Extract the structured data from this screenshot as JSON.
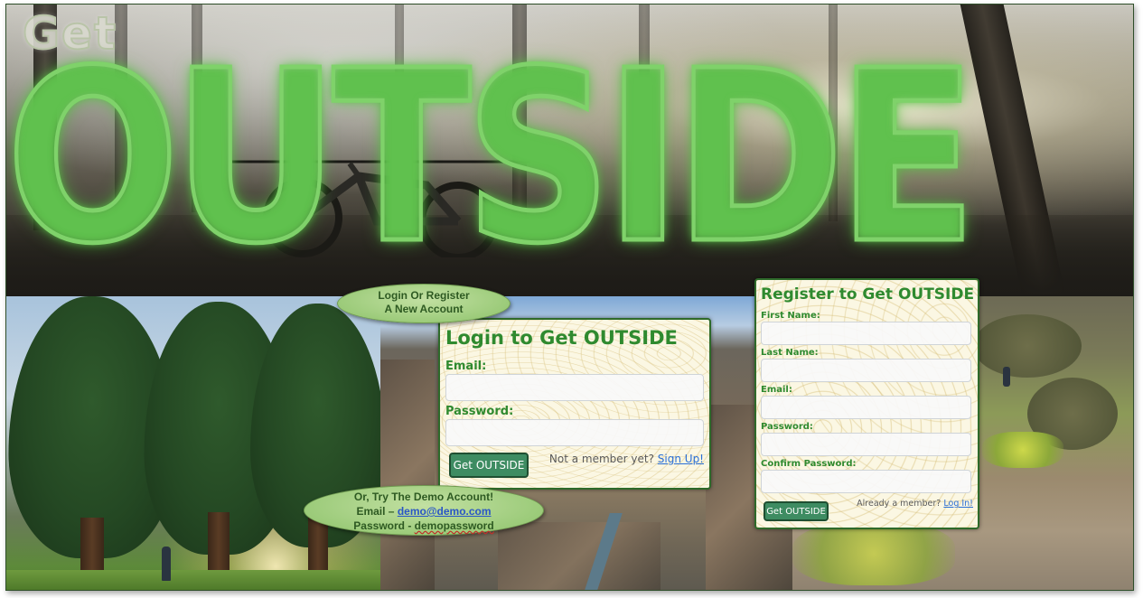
{
  "hero": {
    "get_text": "Get",
    "outside_text": "OUTSIDE"
  },
  "callout_top": {
    "line1": "Login Or Register",
    "line2": "A New Account"
  },
  "callout_demo": {
    "line1": "Or, Try The Demo Account!",
    "email_prefix": "Email – ",
    "email": "demo@demo.com",
    "password_prefix": "Password - ",
    "password": "demopassword"
  },
  "login": {
    "title": "Login to Get OUTSIDE",
    "email_label": "Email:",
    "password_label": "Password:",
    "email_value": "",
    "password_value": "",
    "button_label": "Get OUTSIDE",
    "signup_prompt": "Not a member yet?",
    "signup_link": "Sign Up!"
  },
  "register": {
    "title": "Register to Get OUTSIDE",
    "first_name_label": "First Name:",
    "last_name_label": "Last Name:",
    "email_label": "Email:",
    "password_label": "Password:",
    "confirm_password_label": "Confirm Password:",
    "button_label": "Get OUTSIDE",
    "login_prompt": "Already a member?",
    "login_link": "Log In!"
  },
  "colors": {
    "accent_green": "#2f8a2f",
    "button_green": "#3e8c62",
    "link_blue": "#2a6fd6",
    "glow_green": "#7fd26a"
  }
}
